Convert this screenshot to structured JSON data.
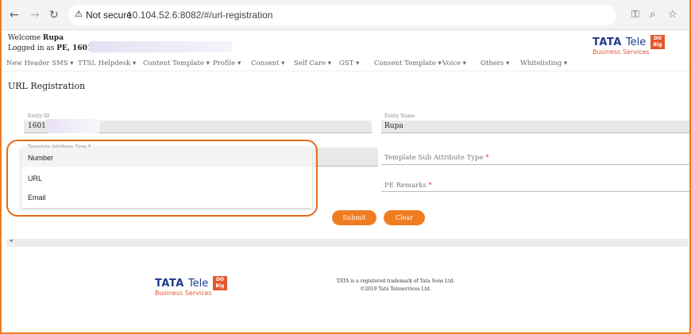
{
  "browser": {
    "security_label": "Not secure",
    "url": "10.104.52.6:8082/#/url-registration"
  },
  "header": {
    "welcome_prefix": "Welcome ",
    "user_name": "Rupa",
    "logged_in_prefix": "Logged in as ",
    "role": "PE, 160150"
  },
  "logo": {
    "brand_word": "TATA",
    "tele_word": "Tele",
    "business_services": "Business Services",
    "badge_line1": "DO",
    "badge_line2": "Big",
    "accent_color": "#e4572e",
    "brand_color": "#1e3c8c"
  },
  "menu": {
    "items": [
      "New Header SMS ▾",
      "TTSL Helpdesk ▾",
      "Content Template ▾",
      "Profile ▾",
      "Consent ▾",
      "Self Care ▾",
      "GST ▾",
      "Consent Template ▾",
      "Voice ▾",
      "Others ▾",
      "Whitelisting ▾"
    ]
  },
  "page": {
    "title": "URL Registration"
  },
  "form": {
    "entity_id_label": "Entity ID",
    "entity_id_value": "1601",
    "entity_name_label": "Entity Name",
    "entity_name_value": "Rupa",
    "template_attr_label": "Template Attribute Type",
    "template_sub_attr_placeholder": "Template Sub Attribute Type",
    "pe_remarks_placeholder": "PE Remarks",
    "required_mark": "*",
    "dropdown_options": [
      "Number",
      "URL",
      "Email"
    ],
    "submit_label": "Submit",
    "clear_label": "Clear"
  },
  "footer": {
    "trademark": "TATA is a registered trademark of Tata Sons Ltd.",
    "copyright": "©2019 Tata Teleservices Ltd."
  },
  "colors": {
    "accent": "#f07c22",
    "highlight_ring": "#e46a1c"
  }
}
